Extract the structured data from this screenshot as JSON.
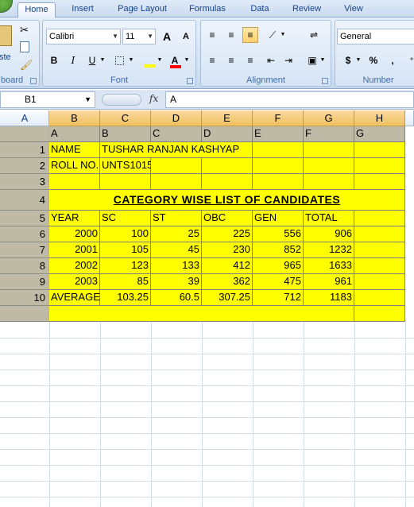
{
  "ribbon": {
    "tabs": [
      "Home",
      "Insert",
      "Page Layout",
      "Formulas",
      "Data",
      "Review",
      "View"
    ],
    "clipboard": {
      "paste_label": "ste",
      "group_label": "board"
    },
    "font": {
      "name": "Calibri",
      "size": "11",
      "grow": "A",
      "shrink": "A",
      "bold": "B",
      "italic": "I",
      "underline": "U",
      "color_letter": "A",
      "group_label": "Font"
    },
    "alignment": {
      "group_label": "Alignment"
    },
    "number": {
      "format": "General",
      "currency": "$",
      "percent": "%",
      "comma": ",",
      "group_label": "Number"
    }
  },
  "formula_bar": {
    "name_box": "B1",
    "fx": "fx",
    "content": "A"
  },
  "sheet": {
    "columns": [
      "A",
      "B",
      "C",
      "D",
      "E",
      "F",
      "G",
      "H"
    ],
    "header_row": [
      "A",
      "B",
      "C",
      "D",
      "E",
      "F",
      "G"
    ],
    "row_numbers": [
      "1",
      "2",
      "3",
      "4",
      "5",
      "6",
      "7",
      "8",
      "9",
      "10"
    ],
    "r1": {
      "label": "NAME",
      "value": "TUSHAR RANJAN KASHYAP"
    },
    "r2": {
      "label": "ROLL NO.",
      "value": "UNTS1015"
    },
    "title": "CATEGORY WISE LIST OF CANDIDATES",
    "table_headers": [
      "YEAR",
      "SC",
      "ST",
      "OBC",
      "GEN",
      "TOTAL"
    ],
    "rows": [
      [
        "2000",
        "100",
        "25",
        "225",
        "556",
        "906"
      ],
      [
        "2001",
        "105",
        "45",
        "230",
        "852",
        "1232"
      ],
      [
        "2002",
        "123",
        "133",
        "412",
        "965",
        "1633"
      ],
      [
        "2003",
        "85",
        "39",
        "362",
        "475",
        "961"
      ],
      [
        "AVERAGE",
        "103.25",
        "60.5",
        "307.25",
        "712",
        "1183"
      ]
    ]
  }
}
